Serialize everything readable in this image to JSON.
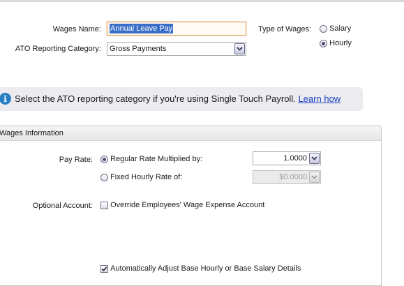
{
  "form": {
    "wages_name_label": "Wages Name:",
    "wages_name_value": "Annual Leave Pay",
    "ato_label": "ATO Reporting Category:",
    "ato_value": "Gross Payments",
    "type_label": "Type of Wages:",
    "type_options": [
      {
        "label": "Salary",
        "checked": false
      },
      {
        "label": "Hourly",
        "checked": true
      }
    ]
  },
  "banner": {
    "text": "Select the ATO reporting category if you're using Single Touch Payroll.",
    "link": "Learn how"
  },
  "group": {
    "title": "Wages Information",
    "pay_rate_label": "Pay Rate:",
    "regular_label": "Regular Rate Multiplied by:",
    "regular_value": "1.0000",
    "fixed_label": "Fixed Hourly Rate of:",
    "fixed_value": "$0.0000",
    "optional_label": "Optional Account:",
    "override_label": "Override Employees' Wage Expense Account",
    "override_checked": false,
    "auto_adjust_label": "Automatically Adjust Base Hourly or Base Salary Details",
    "auto_adjust_checked": true
  }
}
